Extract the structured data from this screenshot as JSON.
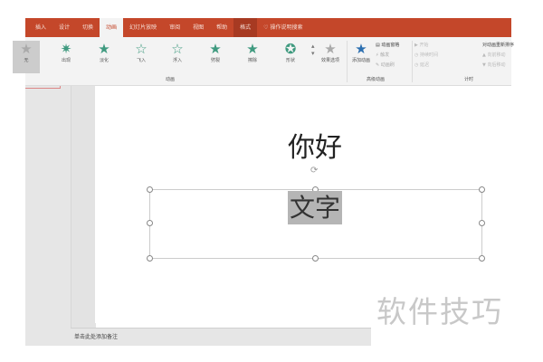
{
  "tabs": [
    "插入",
    "设计",
    "切换",
    "动画",
    "幻灯片放映",
    "审阅",
    "视图",
    "帮助",
    "格式"
  ],
  "search": "操作说明搜索",
  "gallery": [
    "无",
    "出现",
    "淡化",
    "飞入",
    "浮入",
    "劈裂",
    "擦除",
    "形状"
  ],
  "effect_options": "效果选项",
  "add_animation": "添加动画",
  "animation_pane": "动画窗格",
  "trigger": "触发",
  "animation_painter": "动画刷",
  "start": "开始",
  "duration": "持续时间",
  "delay": "延迟",
  "reorder": "对动画重新排序",
  "move_earlier": "向前移动",
  "move_later": "向后移动",
  "groups": {
    "animation": "动画",
    "advanced": "高级动画",
    "timing": "计时"
  },
  "slide": {
    "title": "你好",
    "body": "文字"
  },
  "notes": "单击此处添加备注",
  "watermark": "软件技巧"
}
